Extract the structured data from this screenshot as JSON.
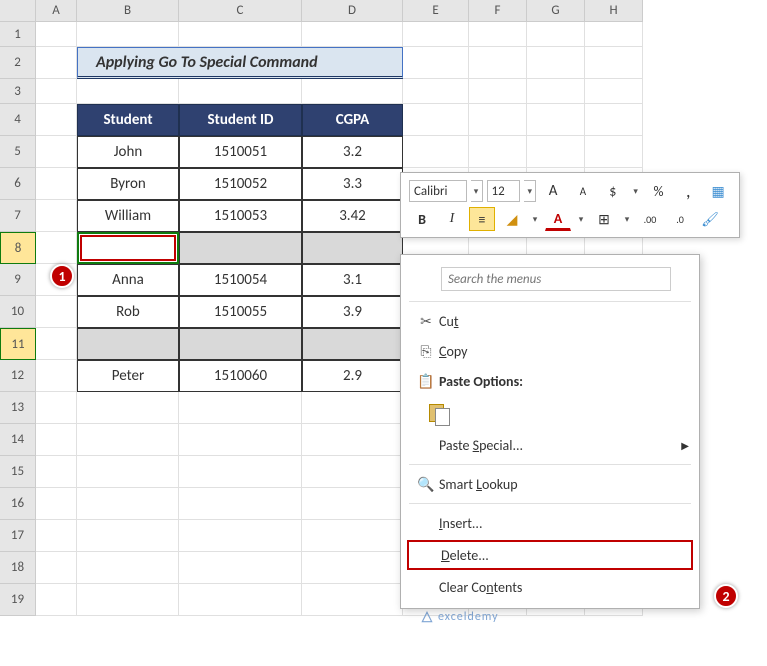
{
  "columns": [
    "A",
    "B",
    "C",
    "D",
    "E",
    "F",
    "G",
    "H"
  ],
  "rownums": [
    "1",
    "2",
    "3",
    "4",
    "5",
    "6",
    "7",
    "8",
    "9",
    "10",
    "11",
    "12",
    "13",
    "14",
    "15",
    "16",
    "17",
    "18",
    "19"
  ],
  "title": "Applying Go To Special Command",
  "headers": {
    "student": "Student",
    "id": "Student ID",
    "cgpa": "CGPA"
  },
  "data": [
    {
      "student": "John",
      "id": "1510051",
      "cgpa": "3.2"
    },
    {
      "student": "Byron",
      "id": "1510052",
      "cgpa": "3.3"
    },
    {
      "student": "William",
      "id": "1510053",
      "cgpa": "3.42"
    },
    {
      "student": "",
      "id": "",
      "cgpa": ""
    },
    {
      "student": "Anna",
      "id": "1510054",
      "cgpa": "3.1"
    },
    {
      "student": "Rob",
      "id": "1510055",
      "cgpa": "3.9"
    },
    {
      "student": "",
      "id": "",
      "cgpa": ""
    },
    {
      "student": "Peter",
      "id": "1510060",
      "cgpa": "2.9"
    }
  ],
  "callouts": {
    "c1": "1",
    "c2": "2"
  },
  "mini": {
    "font": "Calibri",
    "size": "12",
    "incA": "A",
    "decA": "A",
    "dollar": "$",
    "pct": "%",
    "comma": ",",
    "bold": "B",
    "italic": "I",
    "fontcolor": "A"
  },
  "menu": {
    "search_ph": "Search the menus",
    "cut": "Cut",
    "copy": "Copy",
    "paste_opt": "Paste Options:",
    "paste_special": "Paste Special...",
    "smart_lookup": "Smart Lookup",
    "insert": "Insert...",
    "delete": "Delete...",
    "clear": "Clear Contents"
  },
  "watermark": "exceldemy"
}
